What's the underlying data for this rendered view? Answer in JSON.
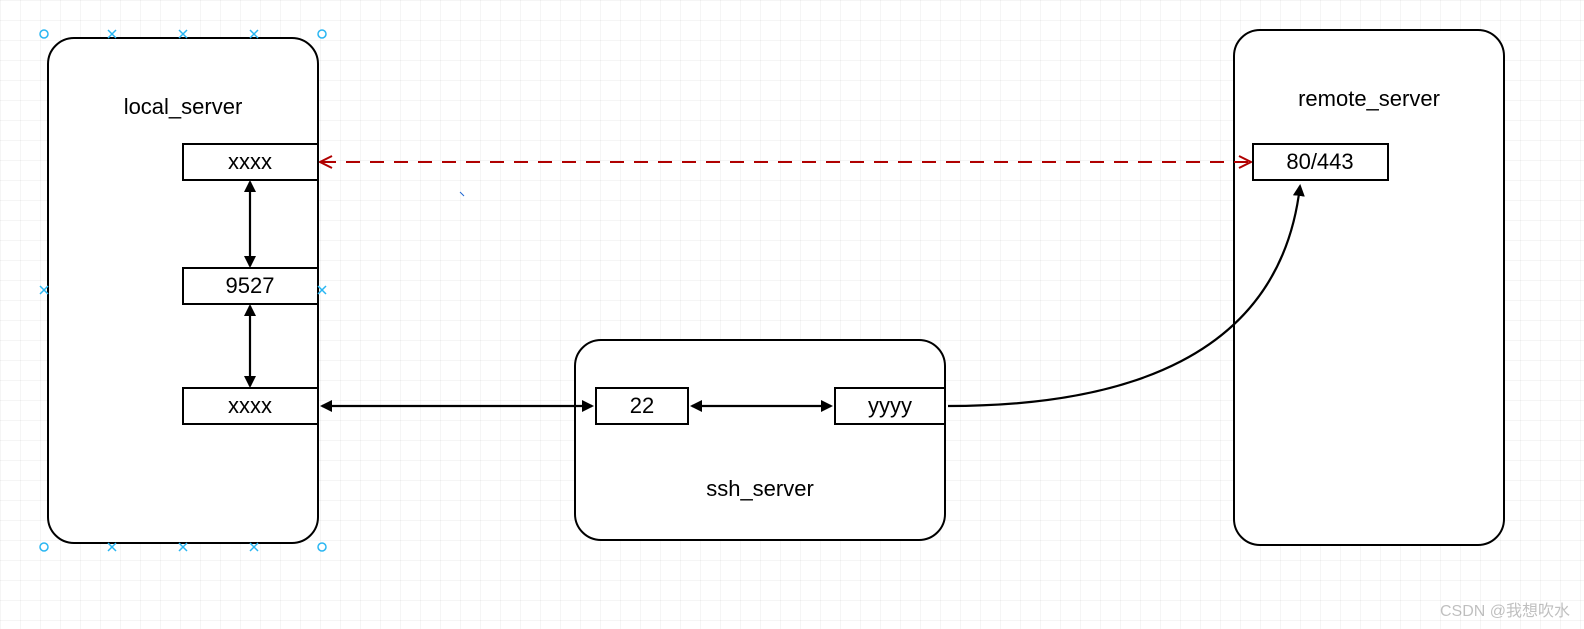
{
  "nodes": {
    "local": {
      "label": "local_server"
    },
    "ssh": {
      "label": "ssh_server"
    },
    "remote": {
      "label": "remote_server"
    }
  },
  "ports": {
    "local_top": {
      "label": "xxxx"
    },
    "local_mid": {
      "label": "9527"
    },
    "local_bot": {
      "label": "xxxx"
    },
    "ssh_left": {
      "label": "22"
    },
    "ssh_right": {
      "label": "yyyy"
    },
    "remote_top": {
      "label": "80/443"
    }
  },
  "watermark": "CSDN @我想吹水",
  "colors": {
    "selection": "#29b6f2",
    "dashed": "#b00000",
    "line": "#000000"
  }
}
